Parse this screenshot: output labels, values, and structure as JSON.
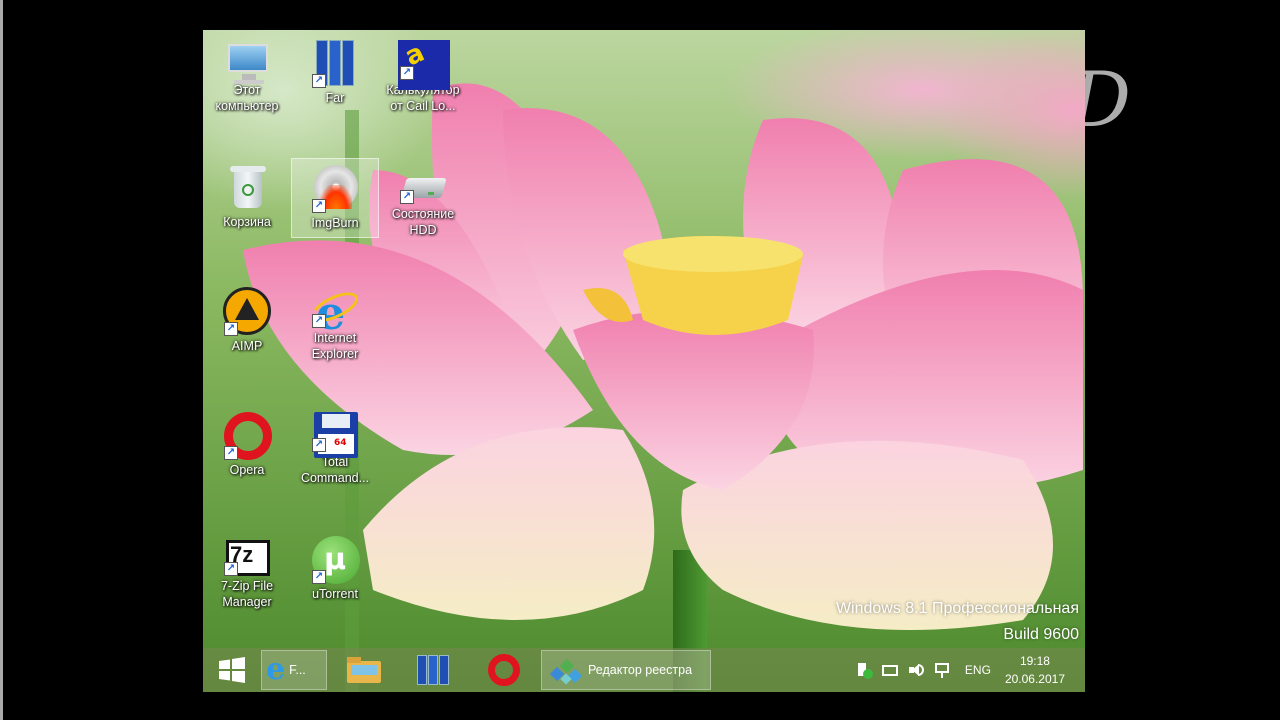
{
  "desktop": {
    "icons": [
      {
        "label": "Этот\nкомпьютер",
        "icon": "computer-icon"
      },
      {
        "label": "Far",
        "icon": "far-manager-icon"
      },
      {
        "label": "Калькулятор\nот Cail Lo...",
        "icon": "calculator-icon"
      },
      {
        "label": "Корзина",
        "icon": "recycle-bin-icon"
      },
      {
        "label": "ImgBurn",
        "icon": "imgburn-icon"
      },
      {
        "label": "Состояние\nHDD",
        "icon": "hdd-icon"
      },
      {
        "label": "AIMP",
        "icon": "aimp-icon"
      },
      {
        "label": "Internet\nExplorer",
        "icon": "internet-explorer-icon"
      },
      {
        "label": "Opera",
        "icon": "opera-icon"
      },
      {
        "label": "Total\nCommand...",
        "icon": "total-commander-icon"
      },
      {
        "label": "7-Zip File\nManager",
        "icon": "seven-zip-icon"
      },
      {
        "label": "uTorrent",
        "icon": "utorrent-icon"
      }
    ],
    "os_line1": "Windows 8.1 Профессиональная",
    "os_line2": "Build 9600"
  },
  "taskbar": {
    "ie_label": "F...",
    "regedit_label": "Редактор реестра",
    "lang": "ENG",
    "time": "19:18",
    "date": "20.06.2017"
  },
  "colors": {
    "pink_petal": "#f4a6c4",
    "pale_petal": "#f7e6c4",
    "center": "#f5d24a",
    "opera_red": "#e0141e",
    "ie_blue": "#1e8fe0"
  },
  "overlay": {
    "channel_mark": "D"
  }
}
